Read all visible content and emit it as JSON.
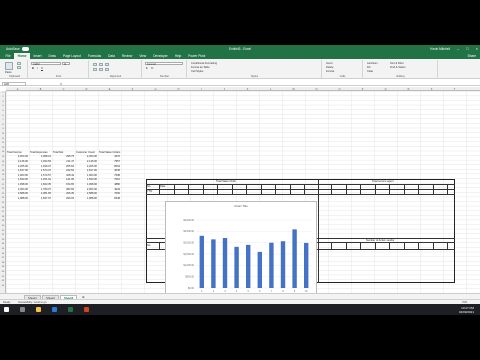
{
  "app": {
    "autosave_label": "AutoSave",
    "autosave_state": "Off",
    "file_title": "Exhibit3 - Excel",
    "user": "Kevin Mitchell"
  },
  "menu_tabs": [
    "File",
    "Home",
    "Insert",
    "Draw",
    "Page Layout",
    "Formulas",
    "Data",
    "Review",
    "View",
    "Developer",
    "Help",
    "Power Pivot"
  ],
  "share_label": "Share",
  "ribbon": {
    "paste": "Paste",
    "font_name": "Calibri",
    "font_size": "11",
    "number_format": "General",
    "conditional_formatting": "Conditional Formatting",
    "format_as_table": "Format as Table",
    "cell_styles": "Cell Styles",
    "insert": "Insert",
    "delete": "Delete",
    "format": "Format",
    "autosum": "AutoSum",
    "fill": "Fill",
    "clear": "Clear",
    "sort_filter": "Sort & Filter",
    "find_select": "Find & Select",
    "groups": [
      "Clipboard",
      "Font",
      "Alignment",
      "Number",
      "Styles",
      "Cells",
      "Editing"
    ]
  },
  "name_box": "G36",
  "columns": [
    "A",
    "B",
    "C",
    "D",
    "E",
    "F",
    "G",
    "H",
    "I",
    "J",
    "K",
    "L",
    "M",
    "N",
    "O",
    "P",
    "Q",
    "R",
    "S",
    "T"
  ],
  "rows": [
    "1",
    "2",
    "3",
    "4",
    "5",
    "6",
    "7",
    "8",
    "9",
    "10",
    "11",
    "12",
    "13",
    "14",
    "15",
    "16",
    "17",
    "18",
    "19",
    "20",
    "21",
    "22",
    "23",
    "24",
    "25",
    "26",
    "27",
    "28",
    "29",
    "30",
    "31",
    "32",
    "33",
    "34",
    "35",
    "36",
    "37",
    "38",
    "39",
    "40",
    "41",
    "42",
    "43"
  ],
  "data_table": {
    "headers": [
      "Total Income",
      "Total Expenses",
      "Total Net",
      "Customer Count",
      "Total Sales Orders"
    ],
    "rows": [
      [
        "2,304.00",
        "1,968.21",
        "335.79",
        "2,304.00",
        "4476"
      ],
      [
        "2,146.00",
        "1,934.53",
        "211.47",
        "2,146.00",
        "7957"
      ],
      [
        "2,205.00",
        "1,939.37",
        "265.63",
        "2,205.00",
        "8604"
      ],
      [
        "1,817.00",
        "1,574.37",
        "242.63",
        "1,817.00",
        "4645"
      ],
      [
        "1,903.00",
        "1,574.57",
        "328.43",
        "1,903.00",
        "7638"
      ],
      [
        "1,593.00",
        "1,451.91",
        "141.09",
        "1,593.00",
        "7616"
      ],
      [
        "1,998.00",
        "1,843.35",
        "154.65",
        "1,998.00",
        "4880"
      ],
      [
        "2,064.00",
        "1,780.07",
        "283.93",
        "2,064.00",
        "4943"
      ],
      [
        "2,588.00",
        "2,381.65",
        "206.35",
        "2,588.00",
        "7606"
      ],
      [
        "1,988.00",
        "1,697.97",
        "290.03",
        "1,988.00",
        "8448"
      ]
    ]
  },
  "panels": {
    "top_left_title": "Total Sales Order",
    "top_right_title": "Total service agent",
    "bottom_left_title": "Return on investment per employee",
    "bottom_right_title": "Number of Active vendor",
    "label_no": "No.",
    "label_date": "Date",
    "label_ytd": "YTD"
  },
  "chart_data": {
    "type": "bar",
    "title": "Chart Title",
    "categories": [
      "1",
      "2",
      "3",
      "4",
      "5",
      "6",
      "7",
      "8",
      "9",
      "10"
    ],
    "values": [
      2304,
      2146,
      2205,
      1817,
      1903,
      1593,
      1998,
      2064,
      2588,
      1988
    ],
    "ylim": [
      0,
      3000
    ],
    "yticks": [
      "$3,000.00",
      "$2,500.00",
      "$2,000.00",
      "$1,500.00",
      "$1,000.00",
      "$500.00",
      "$0.00"
    ],
    "color": "#4472C4",
    "grid": true,
    "legend": "none"
  },
  "sheet_tabs": [
    "Sheet1",
    "Sheet2",
    "Sheet3"
  ],
  "active_sheet": "Sheet3",
  "status": {
    "ready": "Ready",
    "accessibility": "Accessibility: Good to go",
    "zoom": "70%"
  },
  "taskbar": {
    "time": "10:27 PM",
    "date": "04/09/2021"
  }
}
